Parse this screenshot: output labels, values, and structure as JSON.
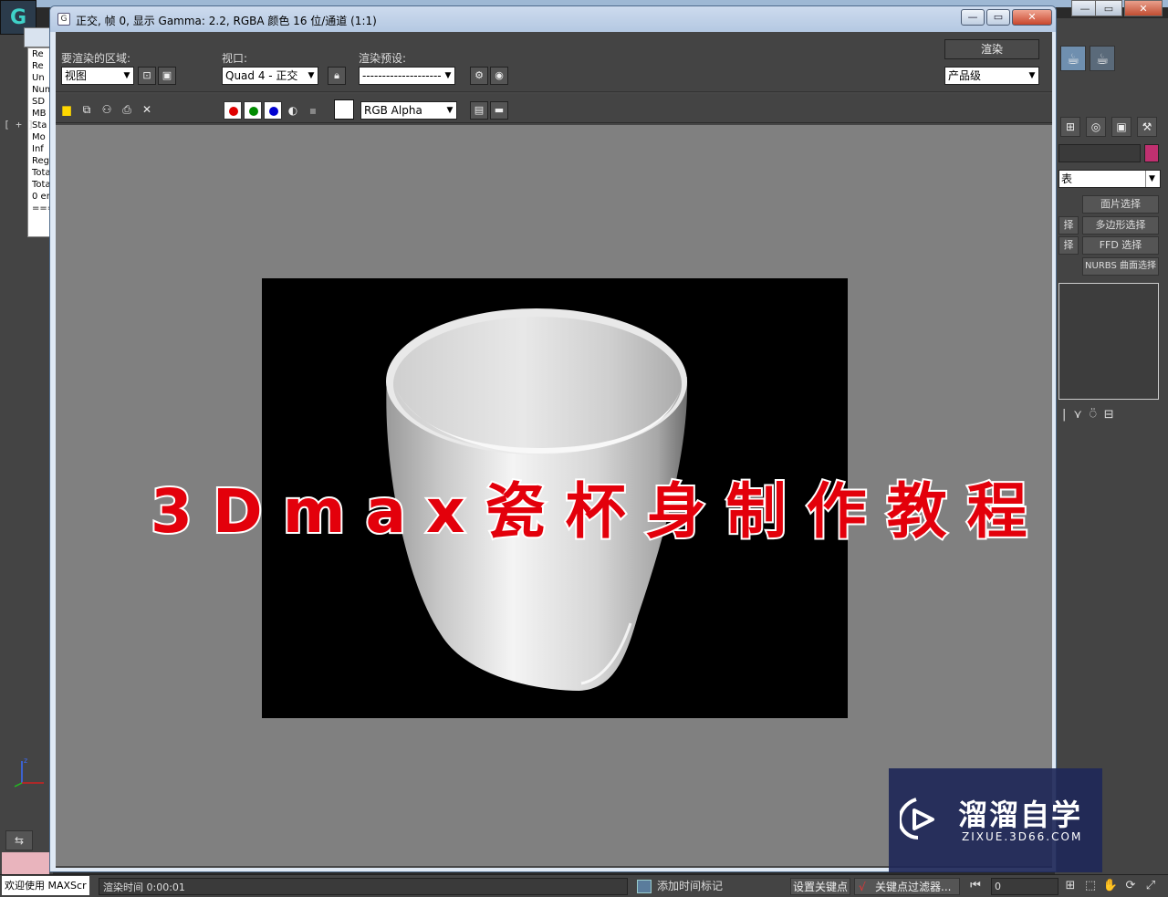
{
  "render_window": {
    "title": "正交, 帧 0, 显示 Gamma: 2.2, RGBA 颜色 16 位/通道 (1:1)",
    "area_label": "要渲染的区域:",
    "area_value": "视图",
    "viewport_label": "视口:",
    "viewport_value": "Quad 4 - 正交",
    "preset_label": "渲染预设:",
    "preset_value": "--------------------",
    "render_button": "渲染",
    "quality_value": "产品级",
    "channel_value": "RGB Alpha"
  },
  "overlay": {
    "title": "3Dmax瓷杯身制作教程"
  },
  "main_app": {
    "left_panel_lines": [
      "Re",
      "Re",
      "Un",
      "Num",
      "SD",
      "MB",
      "Sta",
      "Mo",
      "Inf",
      "Reg",
      "Tota",
      "Tota",
      "0 en",
      "===="
    ],
    "viewport_label": "[ + ]",
    "modifier_dropdown": "表",
    "modifier_buttons": [
      "面片选择",
      "择",
      "多边形选择",
      "择",
      "FFD 选择",
      "NURBS 曲面选择"
    ]
  },
  "status_bar": {
    "welcome": "欢迎使用 MAXScr",
    "render_time": "渲染时间  0:00:01",
    "add_time_tag": "添加时间标记",
    "set_key": "设置关键点",
    "key_filters": "关键点过滤器...",
    "frame": "0"
  },
  "watermark": {
    "name": "溜溜自学",
    "url": "ZIXUE.3D66.COM"
  },
  "colors": {
    "overlay_red": "#e3000b",
    "watermark_bg": "#202858"
  }
}
